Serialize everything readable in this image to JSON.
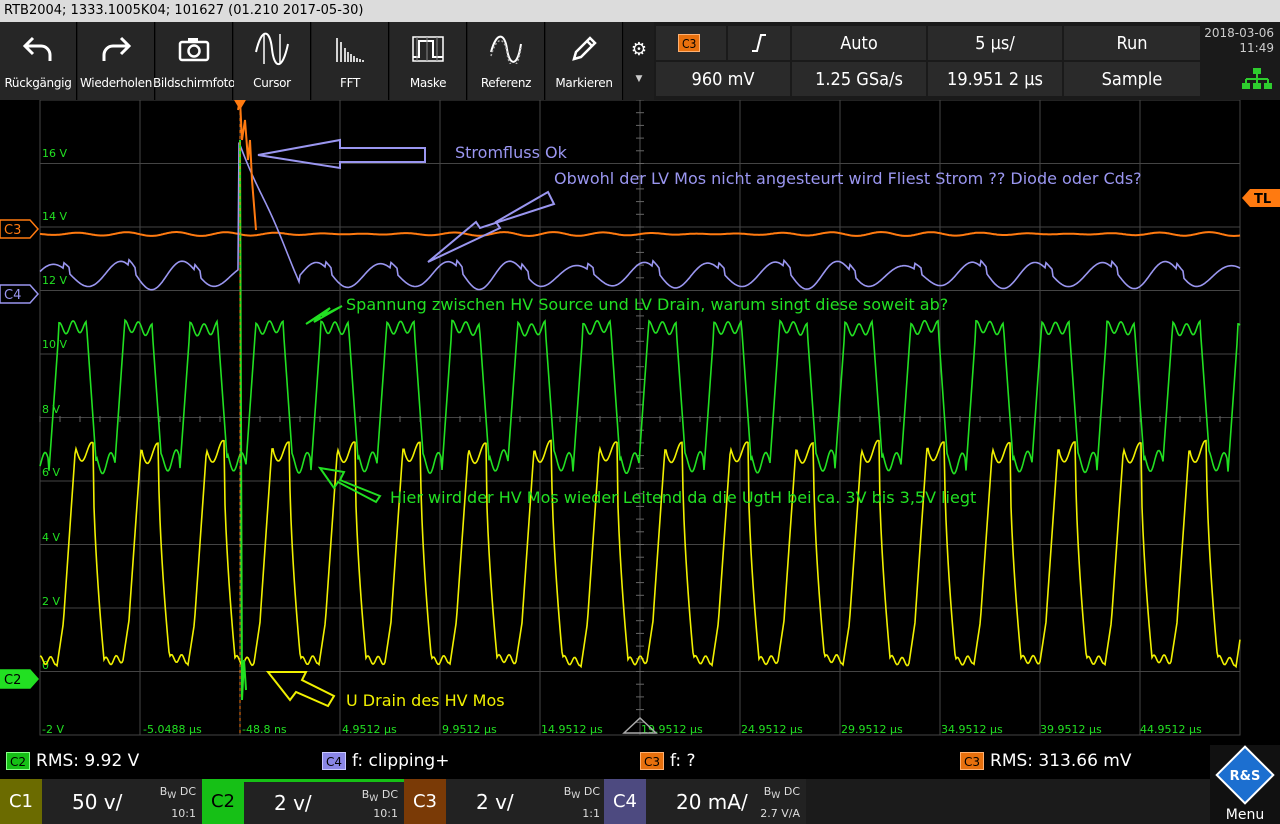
{
  "window": {
    "title": "RTB2004; 1333.1005K04; 101627 (01.210 2017-05-30)"
  },
  "toolbar": {
    "buttons": [
      {
        "label": "Rückgängig",
        "icon": "undo-icon"
      },
      {
        "label": "Wiederholen",
        "icon": "redo-icon"
      },
      {
        "label": "Bildschirmfoto",
        "icon": "camera-icon"
      },
      {
        "label": "Cursor",
        "icon": "cursor-icon"
      },
      {
        "label": "FFT",
        "icon": "fft-icon"
      },
      {
        "label": "Maske",
        "icon": "mask-icon"
      },
      {
        "label": "Referenz",
        "icon": "reference-icon"
      },
      {
        "label": "Markieren",
        "icon": "pencil-icon"
      }
    ]
  },
  "trigger": {
    "source": "C3",
    "slope": "rising-edge-icon",
    "mode": "Auto",
    "timebase": "5 µs/",
    "run_state": "Run",
    "level": "960 mV",
    "sample_rate": "1.25 GSa/s",
    "position": "19.951 2 µs",
    "acq_mode": "Sample"
  },
  "datetime": {
    "date": "2018-03-06",
    "time": "11:49"
  },
  "grid": {
    "y_labels": [
      "16 V",
      "14 V",
      "12 V",
      "10 V",
      "8 V",
      "6 V",
      "4 V",
      "2 V",
      "0",
      "-2 V"
    ],
    "x_labels": [
      "-5.0488 µs",
      "-48.8 ns",
      "4.9512 µs",
      "9.9512 µs",
      "14.9512 µs",
      "19.9512 µs",
      "24.9512 µs",
      "29.9512 µs",
      "34.9512 µs",
      "39.9512 µs",
      "44.9512 µs"
    ]
  },
  "markers": {
    "c3": "C3",
    "c4": "C4",
    "c2": "C2",
    "tl": "TL"
  },
  "annotations": {
    "stromfluss": "Stromfluss Ok",
    "obwohl": "Obwohl der LV Mos nicht angesteurt wird Fliest Strom ??  Diode oder Cds?",
    "spannung": "Spannung zwischen HV Source und LV Drain, warum singt diese soweit ab?",
    "hier": "Hier wird der HV Mos wieder Leitend da die UgtH bei ca. 3V bis 3,5V liegt",
    "udrain": "U Drain des HV Mos"
  },
  "measurements": [
    {
      "channel": "C2",
      "text": "RMS: 9.92 V"
    },
    {
      "channel": "C4",
      "text": "f: clipping+"
    },
    {
      "channel": "C3",
      "text": "f: ?"
    },
    {
      "channel": "C3",
      "text": "RMS: 313.66 mV"
    }
  ],
  "channels": [
    {
      "name": "C1",
      "scale": "50 v/",
      "bw": "DC",
      "ratio": "10:1"
    },
    {
      "name": "C2",
      "scale": "2 v/",
      "bw": "DC",
      "ratio": "10:1"
    },
    {
      "name": "C3",
      "scale": "2 v/",
      "bw": "DC",
      "ratio": "1:1"
    },
    {
      "name": "C4",
      "scale": "20 mA/",
      "bw": "DC",
      "ratio": "2.7 V/A"
    }
  ],
  "bw_prefix": "B",
  "bw_sub": "W",
  "menu": {
    "label": "Menu",
    "logo": "R&S"
  },
  "colors": {
    "c1": "#b8b800",
    "c2": "#22e022",
    "c3": "#ff7a10",
    "c4": "#9a96f0",
    "yellow": "#f0f000",
    "grid": "#444444"
  }
}
